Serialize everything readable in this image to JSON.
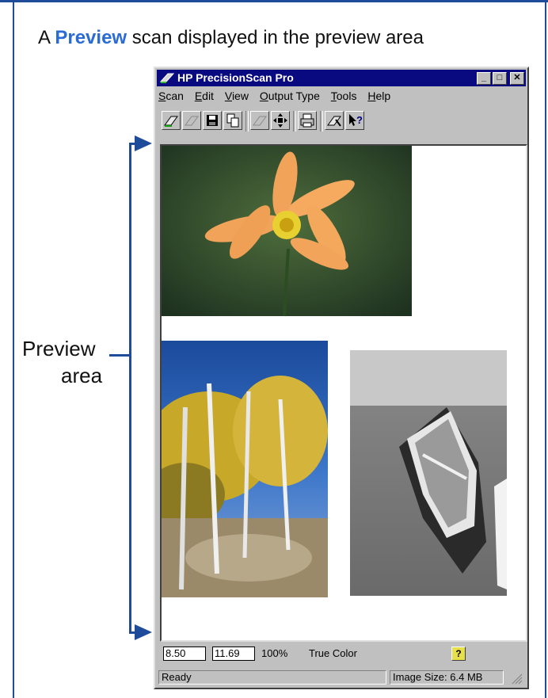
{
  "caption": {
    "prefix": "A",
    "keyword": "Preview",
    "rest": "scan displayed in the preview area"
  },
  "preview_label": {
    "line1": "Preview",
    "line2": "area"
  },
  "window": {
    "title": "HP PrecisionScan Pro",
    "controls": {
      "minimize": "_",
      "maximize": "□",
      "close": "✕"
    },
    "menu": [
      {
        "first": "S",
        "rest": "can"
      },
      {
        "first": "E",
        "rest": "dit"
      },
      {
        "first": "V",
        "rest": "iew"
      },
      {
        "first": "O",
        "rest": "utput Type"
      },
      {
        "first": "T",
        "rest": "ools"
      },
      {
        "first": "H",
        "rest": "elp"
      }
    ],
    "toolbar_icons": [
      "scan-icon",
      "scan-disabled-icon",
      "save-icon",
      "copy-icon",
      "send-disabled-icon",
      "resize-icon",
      "print-icon",
      "settings-icon",
      "context-help-icon"
    ]
  },
  "status": {
    "width": "8.50",
    "height": "11.69",
    "scale": "100%",
    "output_type": "True Color",
    "help_glyph": "?",
    "ready": "Ready",
    "image_size": "Image Size: 6.4 MB"
  },
  "colors": {
    "accent": "#1f4c9a",
    "keyword": "#2b6bd6",
    "titlebar": "#0a0a80"
  }
}
